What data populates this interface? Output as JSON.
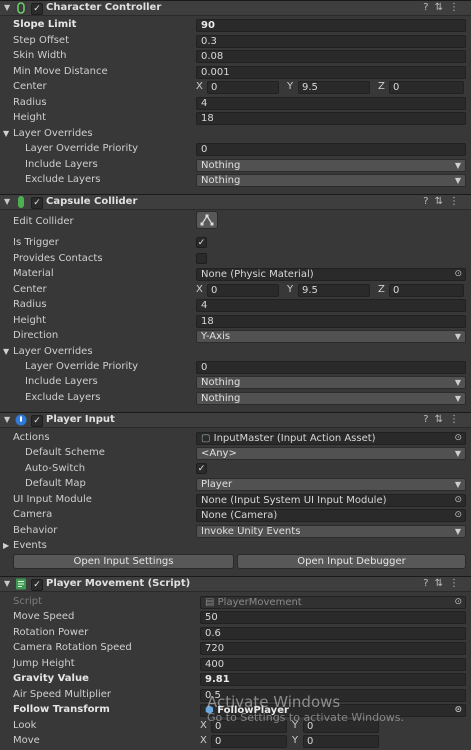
{
  "character_controller": {
    "title": "Character Controller",
    "slope_limit_label": "Slope Limit",
    "slope_limit": "90",
    "step_offset_label": "Step Offset",
    "step_offset": "0.3",
    "skin_width_label": "Skin Width",
    "skin_width": "0.08",
    "min_move_label": "Min Move Distance",
    "min_move": "0.001",
    "center_label": "Center",
    "center_x": "0",
    "center_y": "9.5",
    "center_z": "0",
    "radius_label": "Radius",
    "radius": "4",
    "height_label": "Height",
    "height": "18",
    "layer_overrides_label": "Layer Overrides",
    "priority_label": "Layer Override Priority",
    "priority": "0",
    "include_label": "Include Layers",
    "include": "Nothing",
    "exclude_label": "Exclude Layers",
    "exclude": "Nothing"
  },
  "capsule_collider": {
    "title": "Capsule Collider",
    "edit_label": "Edit Collider",
    "trigger_label": "Is Trigger",
    "contacts_label": "Provides Contacts",
    "material_label": "Material",
    "material": "None (Physic Material)",
    "center_label": "Center",
    "center_x": "0",
    "center_y": "9.5",
    "center_z": "0",
    "radius_label": "Radius",
    "radius": "4",
    "height_label": "Height",
    "height": "18",
    "direction_label": "Direction",
    "direction": "Y-Axis",
    "layer_overrides_label": "Layer Overrides",
    "priority_label": "Layer Override Priority",
    "priority": "0",
    "include_label": "Include Layers",
    "include": "Nothing",
    "exclude_label": "Exclude Layers",
    "exclude": "Nothing"
  },
  "player_input": {
    "title": "Player Input",
    "actions_label": "Actions",
    "actions": "InputMaster (Input Action Asset)",
    "scheme_label": "Default Scheme",
    "scheme": "<Any>",
    "autoswitch_label": "Auto-Switch",
    "map_label": "Default Map",
    "map": "Player",
    "ui_module_label": "UI Input Module",
    "ui_module": "None (Input System UI Input Module)",
    "camera_label": "Camera",
    "camera": "None (Camera)",
    "behavior_label": "Behavior",
    "behavior": "Invoke Unity Events",
    "events_label": "Events",
    "open_settings": "Open Input Settings",
    "open_debugger": "Open Input Debugger"
  },
  "player_movement": {
    "title": "Player Movement (Script)",
    "script_label": "Script",
    "script": "PlayerMovement",
    "move_speed_label": "Move Speed",
    "move_speed": "50",
    "rotation_power_label": "Rotation Power",
    "rotation_power": "0.6",
    "cam_rot_label": "Camera Rotation Speed",
    "cam_rot": "720",
    "jump_label": "Jump Height",
    "jump": "400",
    "gravity_label": "Gravity Value",
    "gravity": "9.81",
    "air_label": "Air Speed Multiplier",
    "air": "0.5",
    "follow_label": "Follow Transform",
    "follow": "FollowPlayer",
    "look_label": "Look",
    "look_x": "0",
    "look_y": "0",
    "move_label": "Move",
    "move_x": "0",
    "move_y": "0"
  },
  "watermark": {
    "line1": "Activate Windows",
    "line2": "Go to Settings to activate Windows."
  },
  "icons": [
    "foldout-arrow-icon",
    "checkbox-icon",
    "help-icon",
    "preset-icon",
    "kebab-menu-icon",
    "object-picker-icon",
    "edit-collider-icon"
  ],
  "colors": {
    "controller_icon": "#4caf50",
    "capsule_icon": "#5cb85c",
    "input_icon": "#2f7ad8",
    "script_icon": "#3f9a50",
    "panel_bg": "#383838"
  }
}
